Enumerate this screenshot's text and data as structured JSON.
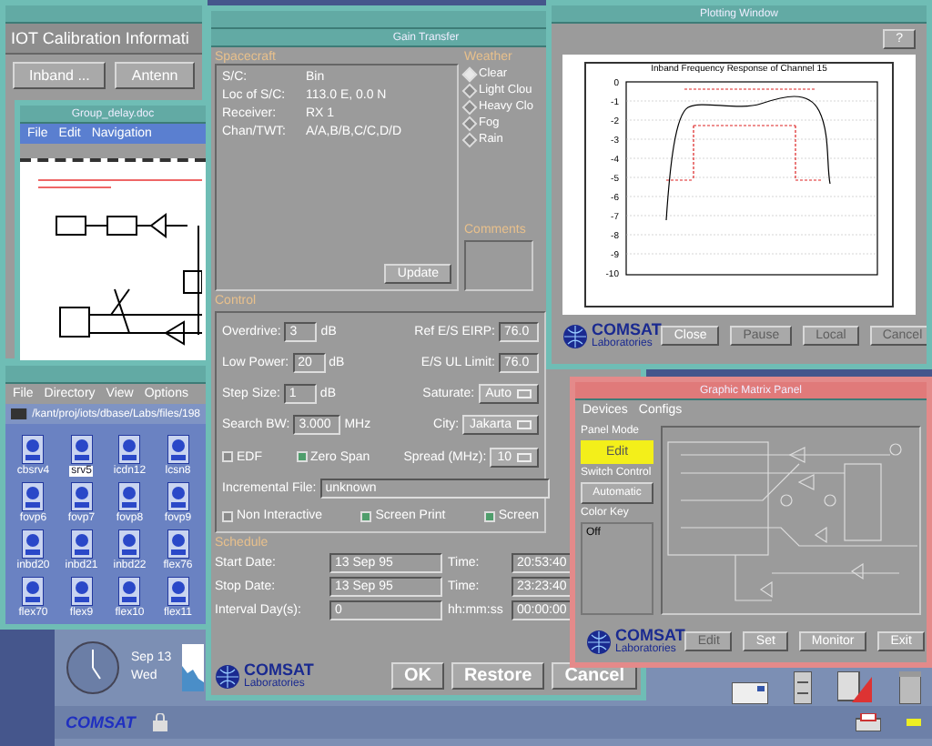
{
  "iot_window": {
    "heading": "IOT Calibration Informati",
    "buttons": [
      "Inband ...",
      "Antenn"
    ]
  },
  "doc_window": {
    "title": "Group_delay.doc",
    "menu": [
      "File",
      "Edit",
      "Navigation"
    ]
  },
  "file_window": {
    "menu": [
      "File",
      "Directory",
      "View",
      "Options"
    ],
    "path": "/kant/proj/iots/dbase/Labs/files/198",
    "files": [
      {
        "name": "cbsrv4",
        "selected": false
      },
      {
        "name": "srv5",
        "selected": true
      },
      {
        "name": "icdn12",
        "selected": false
      },
      {
        "name": "lcsn8",
        "selected": false
      },
      {
        "name": "fovp6",
        "selected": false
      },
      {
        "name": "fovp7",
        "selected": false
      },
      {
        "name": "fovp8",
        "selected": false
      },
      {
        "name": "fovp9",
        "selected": false
      },
      {
        "name": "inbd20",
        "selected": false
      },
      {
        "name": "inbd21",
        "selected": false
      },
      {
        "name": "inbd22",
        "selected": false
      },
      {
        "name": "flex76",
        "selected": false
      },
      {
        "name": "flex70",
        "selected": false
      },
      {
        "name": "flex9",
        "selected": false
      },
      {
        "name": "flex10",
        "selected": false
      },
      {
        "name": "flex11",
        "selected": false
      }
    ]
  },
  "gain_window": {
    "title": "Gain Transfer",
    "spacecraft": {
      "label": "Spacecraft",
      "fields": [
        {
          "label": "S/C:",
          "value": "Bin"
        },
        {
          "label": "Loc of S/C:",
          "value": "113.0 E, 0.0 N"
        },
        {
          "label": "Receiver:",
          "value": "RX 1"
        },
        {
          "label": "Chan/TWT:",
          "value": "A/A,B/B,C/C,D/D"
        }
      ],
      "update": "Update"
    },
    "weather": {
      "label": "Weather",
      "options": [
        {
          "label": "Clear",
          "selected": true
        },
        {
          "label": "Light Clou",
          "selected": false
        },
        {
          "label": "Heavy Clo",
          "selected": false
        },
        {
          "label": "Fog",
          "selected": false
        },
        {
          "label": "Rain",
          "selected": false
        }
      ]
    },
    "comments": {
      "label": "Comments"
    },
    "control": {
      "label": "Control",
      "rows": [
        [
          {
            "kind": "number",
            "label": "Overdrive:",
            "value": "3",
            "unit": "dB"
          },
          {
            "kind": "number",
            "label": "Ref E/S EIRP:",
            "value": "76.0"
          }
        ],
        [
          {
            "kind": "number",
            "label": "Low Power:",
            "value": "20",
            "unit": "dB"
          },
          {
            "kind": "number",
            "label": "E/S UL Limit:",
            "value": "76.0"
          }
        ],
        [
          {
            "kind": "number",
            "label": "Step Size:",
            "value": "1",
            "unit": "dB"
          },
          {
            "kind": "choice",
            "label": "Saturate:",
            "value": "Auto"
          }
        ],
        [
          {
            "kind": "number",
            "label": "Search BW:",
            "value": "3.000",
            "unit": "MHz"
          },
          {
            "kind": "choice",
            "label": "City:",
            "value": "Jakarta"
          }
        ],
        [
          {
            "kind": "check",
            "label": "EDF",
            "checked": false
          },
          {
            "kind": "check",
            "label": "Zero Span",
            "checked": true
          },
          {
            "kind": "choice",
            "label": "Spread (MHz):",
            "value": "10"
          }
        ],
        [
          {
            "kind": "text",
            "label": "Incremental File:",
            "value": "unknown"
          }
        ],
        [
          {
            "kind": "check",
            "label": "Non Interactive",
            "checked": false
          },
          {
            "kind": "check",
            "label": "Screen Print",
            "checked": true
          },
          {
            "kind": "check",
            "label": "Screen",
            "checked": true
          }
        ]
      ]
    },
    "schedule": {
      "label": "Schedule",
      "rows": [
        {
          "label": "Start  Date:",
          "value": "13 Sep 95",
          "time_label": "Time:",
          "time": "20:53:40"
        },
        {
          "label": "Stop  Date:",
          "value": "13 Sep 95",
          "time_label": "Time:",
          "time": "23:23:40"
        },
        {
          "label": "Interval  Day(s):",
          "value": "0",
          "time_label": "hh:mm:ss",
          "time": "00:00:00"
        }
      ]
    },
    "logo": {
      "name": "COMSAT",
      "sub": "Laboratories"
    },
    "buttons": [
      "OK",
      "Restore",
      "Cancel"
    ]
  },
  "plot_window": {
    "title": "Plotting Window",
    "help": "?",
    "plot": {
      "title": "Inband Frequency Response of Channel 15",
      "y_ticks": [
        "0",
        "-1",
        "-2",
        "-3",
        "-4",
        "-5",
        "-6",
        "-7",
        "-8",
        "-9",
        "-10"
      ]
    },
    "logo": {
      "name": "COMSAT",
      "sub": "Laboratories"
    },
    "buttons": [
      {
        "label": "Close",
        "disabled": false
      },
      {
        "label": "Pause",
        "disabled": true
      },
      {
        "label": "Local",
        "disabled": true
      },
      {
        "label": "Cancel",
        "disabled": true
      }
    ]
  },
  "matrix_window": {
    "title": "Graphic Matrix Panel",
    "menu": [
      "Devices",
      "Configs"
    ],
    "panel_mode": {
      "label": "Panel Mode",
      "value": "Edit"
    },
    "switch_control": {
      "label": "Switch Control",
      "value": "Automatic"
    },
    "color_key": {
      "label": "Color Key",
      "entries": [
        "Off"
      ]
    },
    "logo": {
      "name": "COMSAT",
      "sub": "Laboratories"
    },
    "buttons": [
      {
        "label": "Edit",
        "disabled": true
      },
      {
        "label": "Set",
        "disabled": false
      },
      {
        "label": "Monitor",
        "disabled": false
      },
      {
        "label": "Exit",
        "disabled": false
      }
    ]
  },
  "taskbar": {
    "date": "Sep 13",
    "day": "Wed",
    "brand": "COMSAT"
  }
}
